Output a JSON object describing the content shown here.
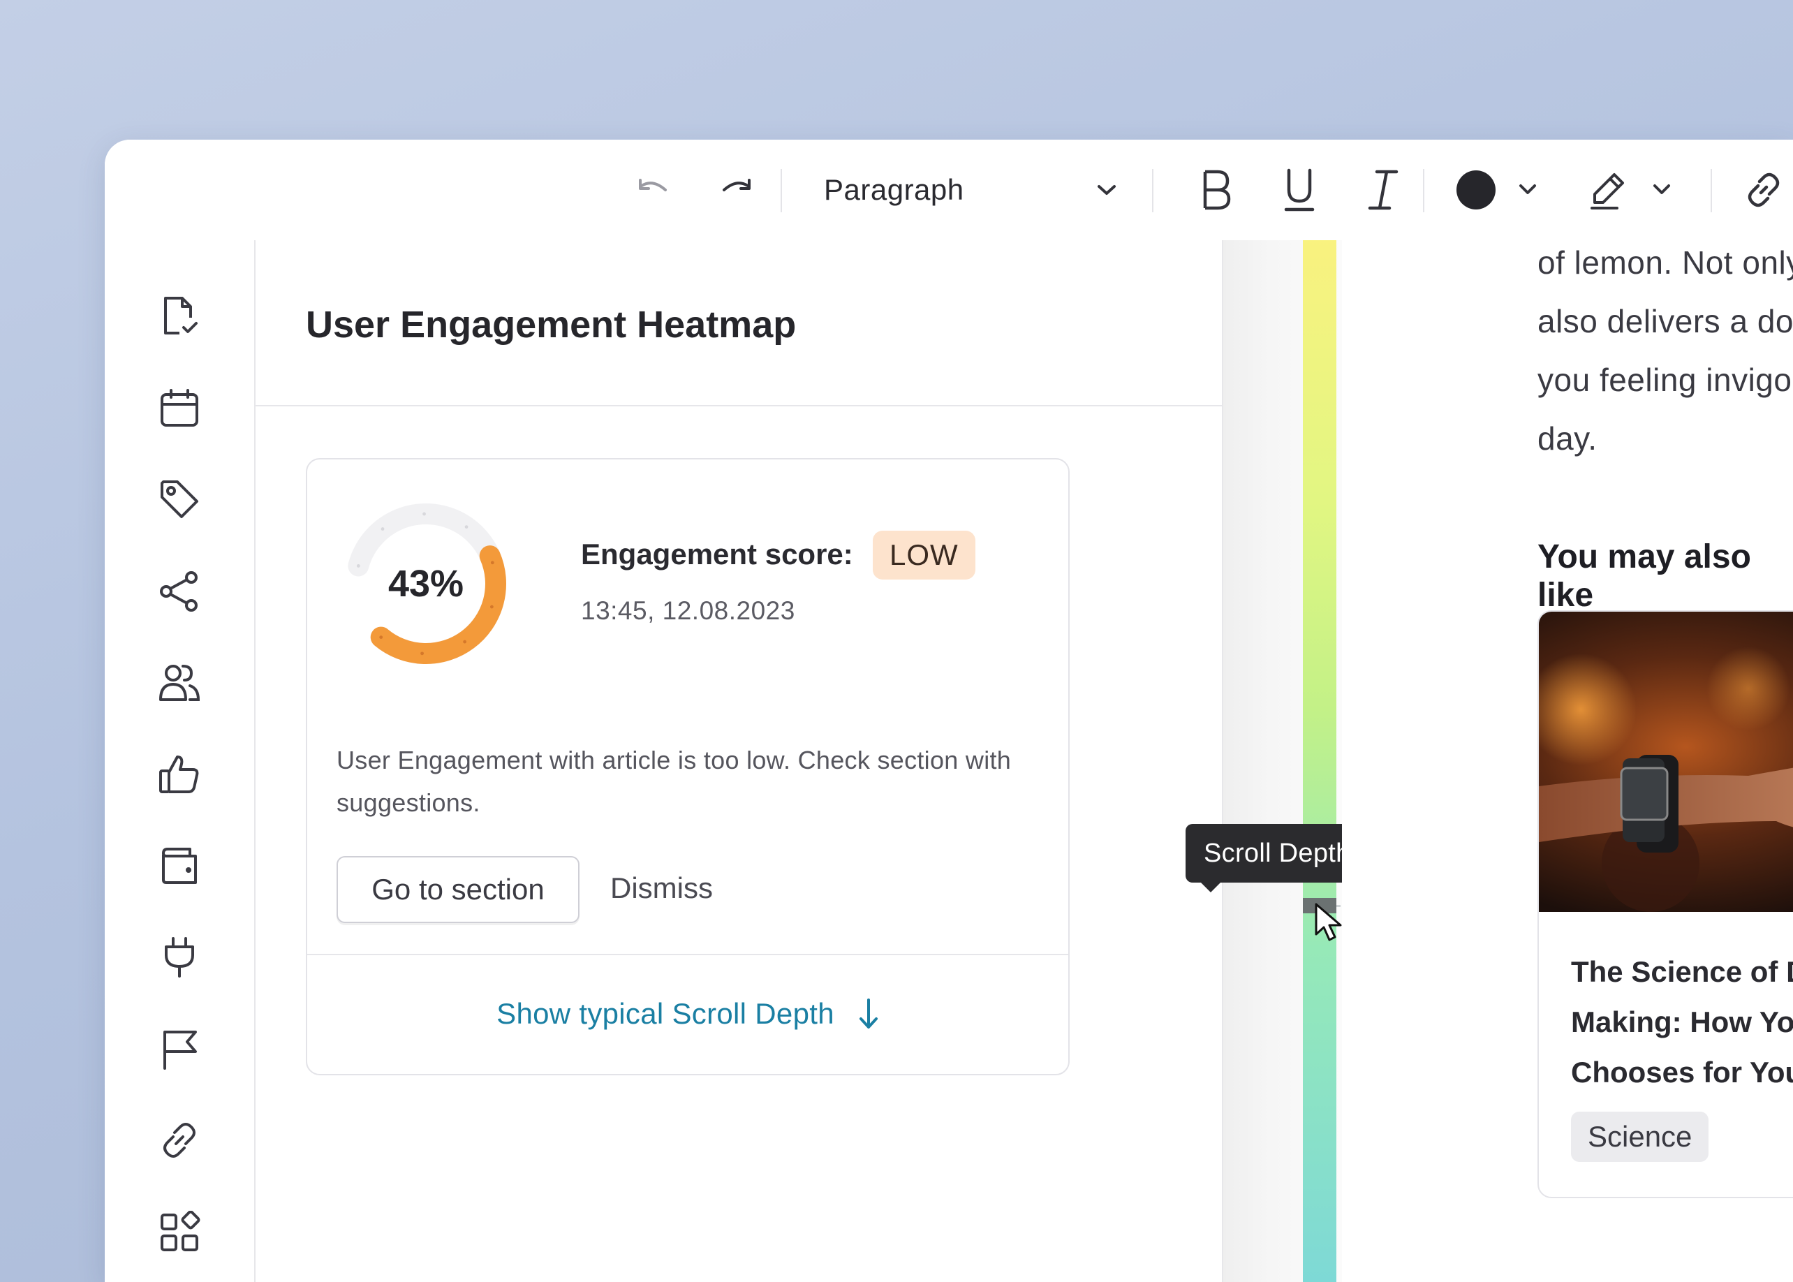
{
  "toolbar": {
    "block_type": "Paragraph",
    "tools": [
      "undo-icon",
      "redo-icon",
      "bold-icon",
      "underline-icon",
      "italic-icon",
      "text-color-icon",
      "highlight-pen-icon",
      "link-icon"
    ],
    "text_color": "#26262b"
  },
  "sidebar": {
    "items": [
      "document-check-icon",
      "calendar-icon",
      "tag-icon",
      "share-icon",
      "users-icon",
      "thumbs-up-icon",
      "wallet-icon",
      "plug-icon",
      "flag-icon",
      "link-icon",
      "apps-icon"
    ]
  },
  "panel": {
    "title": "User Engagement Heatmap",
    "engagement": {
      "percent": 43,
      "percent_label": "43%",
      "score_label": "Engagement score:",
      "level": "LOW",
      "timestamp": "13:45, 12.08.2023",
      "message": "User Engagement with article is too low. Check section with suggestions.",
      "go_to_section": "Go to section",
      "dismiss": "Dismiss",
      "show_scroll_depth": "Show typical Scroll Depth"
    },
    "colors": {
      "gauge": "#f39a3a",
      "badge_bg": "#fde3cd",
      "link": "#1a7fa3"
    }
  },
  "heatmap": {
    "tooltip": "Scroll Depth",
    "gradient": [
      "#f9f27f",
      "#e2f682",
      "#c3f187",
      "#96e9b8",
      "#7ed9d6"
    ]
  },
  "article": {
    "lines": [
      "of lemon. Not only doe",
      "also delivers a dose of",
      "you feeling invigorated",
      "day."
    ],
    "also_like": "You may also like",
    "recommendation": {
      "title_lines": [
        "The Science of Decisio",
        "Making: How Your Brai",
        "Chooses for You"
      ],
      "tag": "Science"
    }
  }
}
